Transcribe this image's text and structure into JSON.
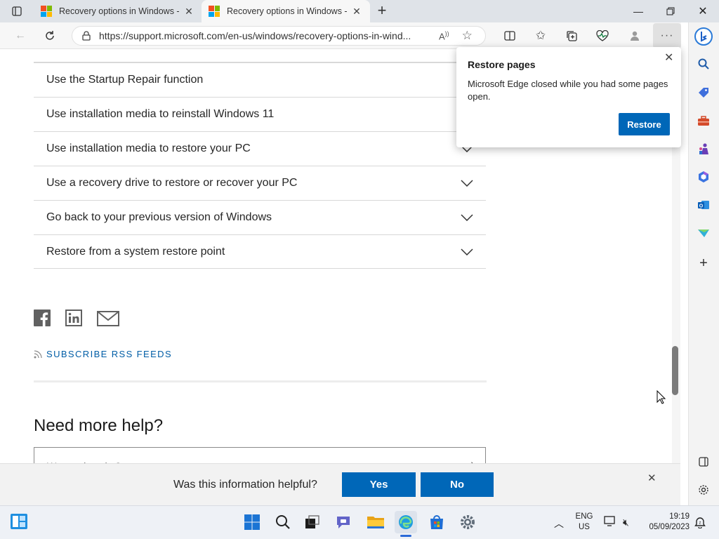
{
  "browser": {
    "tabs": [
      {
        "title": "Recovery options in Windows - M"
      },
      {
        "title": "Recovery options in Windows - M"
      }
    ],
    "url": "https://support.microsoft.com/en-us/windows/recovery-options-in-wind..."
  },
  "accordion": [
    {
      "label": "Use the Startup Repair function"
    },
    {
      "label": "Use installation media to reinstall Windows 11"
    },
    {
      "label": "Use installation media to restore your PC"
    },
    {
      "label": "Use a recovery drive to restore or recover your PC"
    },
    {
      "label": "Go back to your previous version of Windows"
    },
    {
      "label": "Restore from a system restore point"
    }
  ],
  "subscribe_label": "SUBSCRIBE RSS FEEDS",
  "need_help": {
    "heading": "Need more help?",
    "search_partial": "W...  ...ed... ...l...?"
  },
  "feedback": {
    "question": "Was this information helpful?",
    "yes": "Yes",
    "no": "No"
  },
  "popup": {
    "title": "Restore pages",
    "message": "Microsoft Edge closed while you had some pages open.",
    "button": "Restore"
  },
  "taskbar": {
    "lang_top": "ENG",
    "lang_bottom": "US",
    "time": "19:19",
    "date": "05/09/2023"
  },
  "colors": {
    "accent": "#0067b8",
    "link": "#005da6"
  }
}
